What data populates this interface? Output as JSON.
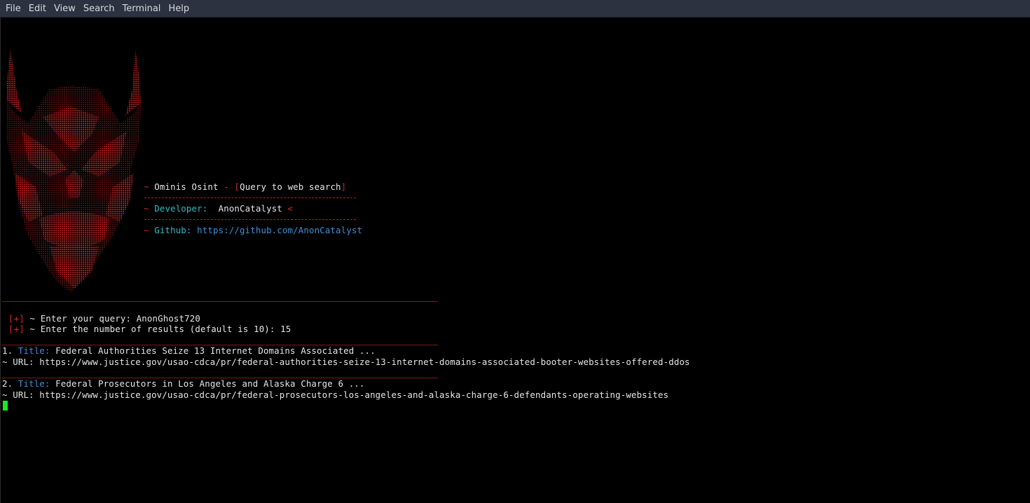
{
  "menu": [
    "File",
    "Edit",
    "View",
    "Search",
    "Terminal",
    "Help"
  ],
  "banner": {
    "tilde": "~",
    "tool_name": "Ominis Osint",
    "dash": "-",
    "bracket_open": "[",
    "tagline": "Query to web search",
    "bracket_close": "]",
    "developer_label": "Developer:",
    "developer_name": "AnonCatalyst",
    "developer_suffix": "<",
    "github_label": "Github:",
    "github_url": "https://github.com/AnonCatalyst"
  },
  "prompts": [
    {
      "marker": "[+]",
      "text": "~ Enter your query: AnonGhost720"
    },
    {
      "marker": "[+]",
      "text": "~ Enter the number of results (default is 10): 15"
    }
  ],
  "results": [
    {
      "num": "1.",
      "title_label": "Title:",
      "title": "Federal Authorities Seize 13 Internet Domains Associated ...",
      "url_line": "~ URL: https://www.justice.gov/usao-cdca/pr/federal-authorities-seize-13-internet-domains-associated-booter-websites-offered-ddos"
    },
    {
      "num": "2.",
      "title_label": "Title:",
      "title": "Federal Prosecutors in Los Angeles and Alaska Charge 6 ...",
      "url_line": "~ URL: https://www.justice.gov/usao-cdca/pr/federal-prosecutors-los-angeles-and-alaska-charge-6-defendants-operating-websites"
    }
  ],
  "colors": {
    "background": "#000000",
    "menubar": "#2d3240",
    "red": "#d22a2a",
    "cyan": "#37b9c6",
    "blue": "#3f8fd6",
    "text": "#e6e6e6",
    "cursor": "#1ee81e"
  },
  "icons": [
    "devil-ascii-art"
  ]
}
